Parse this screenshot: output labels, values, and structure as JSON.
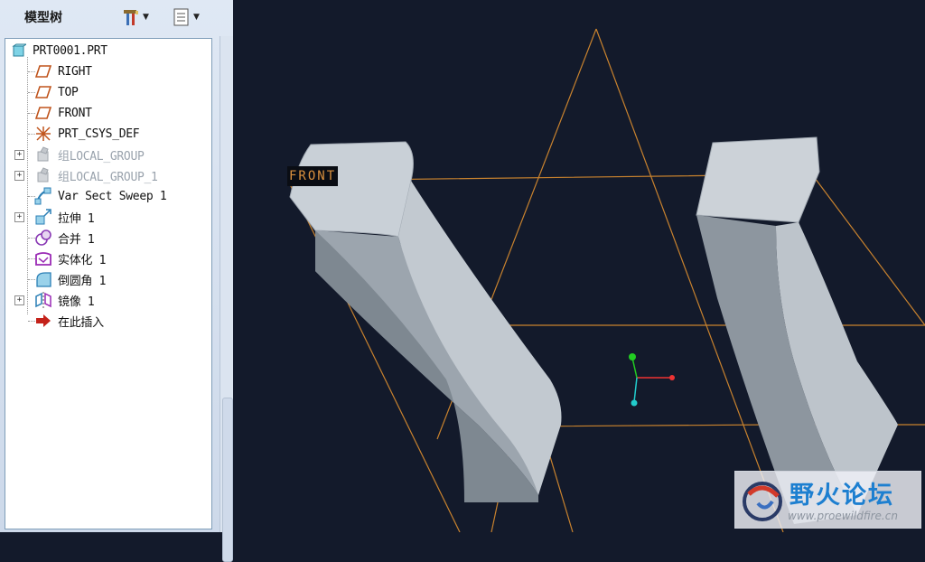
{
  "panel": {
    "title": "模型树",
    "settings_icon": "tools-settings-icon",
    "show_icon": "tree-show-icon"
  },
  "tree": {
    "items": [
      {
        "label": "PRT0001.PRT",
        "icon": "part-icon",
        "expandable": false,
        "dim": false
      },
      {
        "label": "RIGHT",
        "icon": "datum-plane-icon",
        "expandable": false,
        "dim": false
      },
      {
        "label": "TOP",
        "icon": "datum-plane-icon",
        "expandable": false,
        "dim": false
      },
      {
        "label": "FRONT",
        "icon": "datum-plane-icon",
        "expandable": false,
        "dim": false
      },
      {
        "label": "PRT_CSYS_DEF",
        "icon": "csys-icon",
        "expandable": false,
        "dim": false
      },
      {
        "label": "组LOCAL_GROUP",
        "icon": "local-group-icon",
        "expandable": true,
        "dim": true
      },
      {
        "label": "组LOCAL_GROUP_1",
        "icon": "local-group-icon",
        "expandable": true,
        "dim": true
      },
      {
        "label": "Var Sect Sweep 1",
        "icon": "var-sect-sweep-icon",
        "expandable": false,
        "dim": false
      },
      {
        "label": "拉伸 1",
        "icon": "extrude-icon",
        "expandable": true,
        "dim": false
      },
      {
        "label": "合并 1",
        "icon": "merge-icon",
        "expandable": false,
        "dim": false
      },
      {
        "label": "实体化 1",
        "icon": "solidify-icon",
        "expandable": false,
        "dim": false
      },
      {
        "label": "倒圆角 1",
        "icon": "round-icon",
        "expandable": false,
        "dim": false
      },
      {
        "label": "镜像 1",
        "icon": "mirror-icon",
        "expandable": true,
        "dim": false
      },
      {
        "label": "在此插入",
        "icon": "insert-here-arrow-icon",
        "expandable": false,
        "dim": false
      }
    ]
  },
  "viewport": {
    "datum_label": "FRONT",
    "background": "#131a2b",
    "model_color": "#b4bcc5",
    "datum_color": "#c8822e"
  },
  "watermark": {
    "title": "野火论坛",
    "url": "www.proewildfire.cn"
  }
}
